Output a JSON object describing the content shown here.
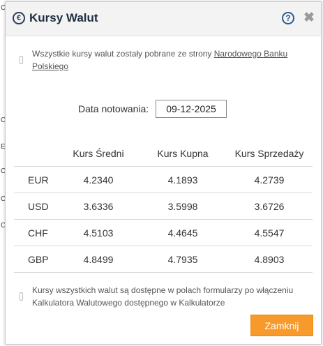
{
  "background": {
    "chars": [
      "C",
      "C",
      "E",
      "C",
      "C",
      "C"
    ]
  },
  "dialog": {
    "title": "Kursy Walut",
    "title_icon": "euro-icon",
    "help_symbol": "?",
    "close_symbol": "✖",
    "info_top_before_link": "Wszystkie kursy walut zostały pobrane ze strony ",
    "info_top_link": "Narodowego Banku Polskiego",
    "date_label": "Data notowania:",
    "date_value": "09-12-2025",
    "table": {
      "headers": [
        "",
        "Kurs Średni",
        "Kurs Kupna",
        "Kurs Sprzedaży"
      ],
      "rows": [
        {
          "currency": "EUR",
          "mid": "4.2340",
          "buy": "4.1893",
          "sell": "4.2739"
        },
        {
          "currency": "USD",
          "mid": "3.6336",
          "buy": "3.5998",
          "sell": "3.6726"
        },
        {
          "currency": "CHF",
          "mid": "4.5103",
          "buy": "4.4645",
          "sell": "4.5547"
        },
        {
          "currency": "GBP",
          "mid": "4.8499",
          "buy": "4.7935",
          "sell": "4.8903"
        }
      ]
    },
    "info_bottom": "Kursy wszystkich walut są dostępne w polach formularzy po włączeniu Kalkulatora Walutowego dostępnego w Kalkulatorze",
    "close_button_label": "Zamknij",
    "colors": {
      "accent": "#f79a2b",
      "header_bg": "#f3f3f3",
      "title": "#1f2d3f"
    }
  }
}
